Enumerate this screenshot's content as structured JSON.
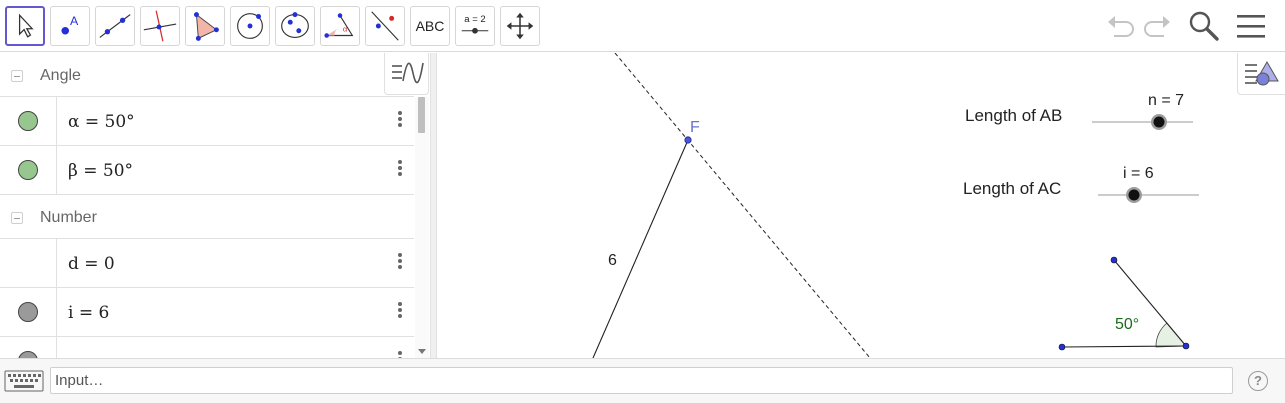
{
  "toolbar": {
    "tools": [
      {
        "name": "move-tool",
        "active": true
      },
      {
        "name": "point-tool"
      },
      {
        "name": "line-tool"
      },
      {
        "name": "perpendicular-line-tool"
      },
      {
        "name": "polygon-tool"
      },
      {
        "name": "circle-center-point-tool"
      },
      {
        "name": "ellipse-tool"
      },
      {
        "name": "angle-tool"
      },
      {
        "name": "reflect-tool"
      },
      {
        "name": "text-tool",
        "label": "ABC"
      },
      {
        "name": "slider-tool",
        "label": "a = 2"
      },
      {
        "name": "move-graphics-view-tool"
      }
    ],
    "right_icons": [
      "undo-icon",
      "redo-icon",
      "search-icon",
      "menu-icon"
    ]
  },
  "algebra": {
    "categories": {
      "angle": "Angle",
      "number": "Number"
    },
    "items": {
      "alpha": "α = 50°",
      "beta": "β = 50°",
      "d": "d = 0",
      "i": "i = 6"
    },
    "colors": {
      "angle_dot": "#97c68e",
      "number_dot": "#9a9a9a"
    }
  },
  "graphics": {
    "point_f_label": "F",
    "segment_label": "6",
    "slider_ab_caption": "Length of AB",
    "slider_ab_value": "n = 7",
    "slider_ac_caption": "Length of AC",
    "slider_ac_value": "i = 6",
    "angle_label": "50°",
    "colors": {
      "point": "#2330d8",
      "point_label": "#6a6fd4",
      "angle_text": "#1a6b1a",
      "angle_fill": "#e6f0e3"
    }
  },
  "input_bar": {
    "placeholder": "Input…",
    "help": "?"
  }
}
